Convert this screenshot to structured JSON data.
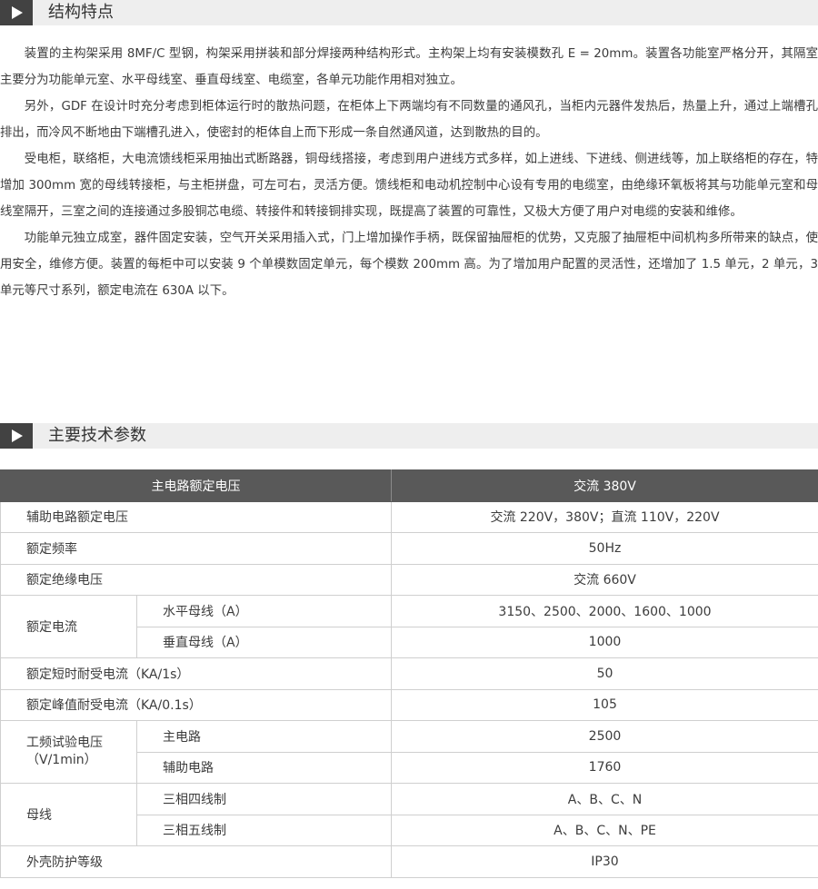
{
  "sections": {
    "structure_title": "结构特点",
    "specs_title": "主要技术参数"
  },
  "paragraphs": [
    "装置的主构架采用 8MF/C 型钢，构架采用拼装和部分焊接两种结构形式。主构架上均有安装模数孔 E = 20mm。装置各功能室严格分开，其隔室主要分为功能单元室、水平母线室、垂直母线室、电缆室，各单元功能作用相对独立。",
    "另外，GDF 在设计时充分考虑到柜体运行时的散热问题，在柜体上下两端均有不同数量的通风孔，当柜内元器件发热后，热量上升，通过上端槽孔排出，而冷风不断地由下端槽孔进入，使密封的柜体自上而下形成一条自然通风道，达到散热的目的。",
    "受电柜，联络柜，大电流馈线柜采用抽出式断路器，铜母线搭接，考虑到用户进线方式多样，如上进线、下进线、侧进线等，加上联络柜的存在，特增加 300mm 宽的母线转接柜，与主柜拼盘，可左可右，灵活方便。馈线柜和电动机控制中心设有专用的电缆室，由绝缘环氧板将其与功能单元室和母线室隔开，三室之间的连接通过多股铜芯电缆、转接件和转接铜排实现，既提高了装置的可靠性，又极大方便了用户对电缆的安装和维修。",
    "功能单元独立成室，器件固定安装，空气开关采用插入式，门上增加操作手柄，既保留抽屉柜的优势，又克服了抽屉柜中间机构多所带来的缺点，使用安全，维修方便。装置的每柜中可以安装 9 个单模数固定单元，每个模数 200mm 高。为了增加用户配置的灵活性，还增加了 1.5 单元，2 单元，3 单元等尺寸系列，额定电流在 630A 以下。"
  ],
  "table": {
    "header": {
      "param": "主电路额定电压",
      "value": "交流 380V"
    },
    "aux_voltage": {
      "label": "辅助电路额定电压",
      "value": "交流 220V，380V；直流 110V，220V"
    },
    "frequency": {
      "label": "额定频率",
      "value": "50Hz"
    },
    "insulation": {
      "label": "额定绝缘电压",
      "value": "交流 660V"
    },
    "rated_current": {
      "label": "额定电流",
      "horizontal_label": "水平母线（A）",
      "horizontal_value": "3150、2500、2000、1600、1000",
      "vertical_label": "垂直母线（A）",
      "vertical_value": "1000"
    },
    "short_time": {
      "label": "额定短时耐受电流（KA/1s）",
      "value": "50"
    },
    "peak": {
      "label": "额定峰值耐受电流（KA/0.1s）",
      "value": "105"
    },
    "test_voltage": {
      "label_line1": "工频试验电压",
      "label_line2": "（V/1min）",
      "main_label": "主电路",
      "main_value": "2500",
      "aux_label": "辅助电路",
      "aux_value": "1760"
    },
    "busbar": {
      "label": "母线",
      "four_wire_label": "三相四线制",
      "four_wire_value": "A、B、C、N",
      "five_wire_label": "三相五线制",
      "five_wire_value": "A、B、C、N、PE"
    },
    "protection": {
      "label": "外壳防护等级",
      "value": "IP30"
    }
  }
}
